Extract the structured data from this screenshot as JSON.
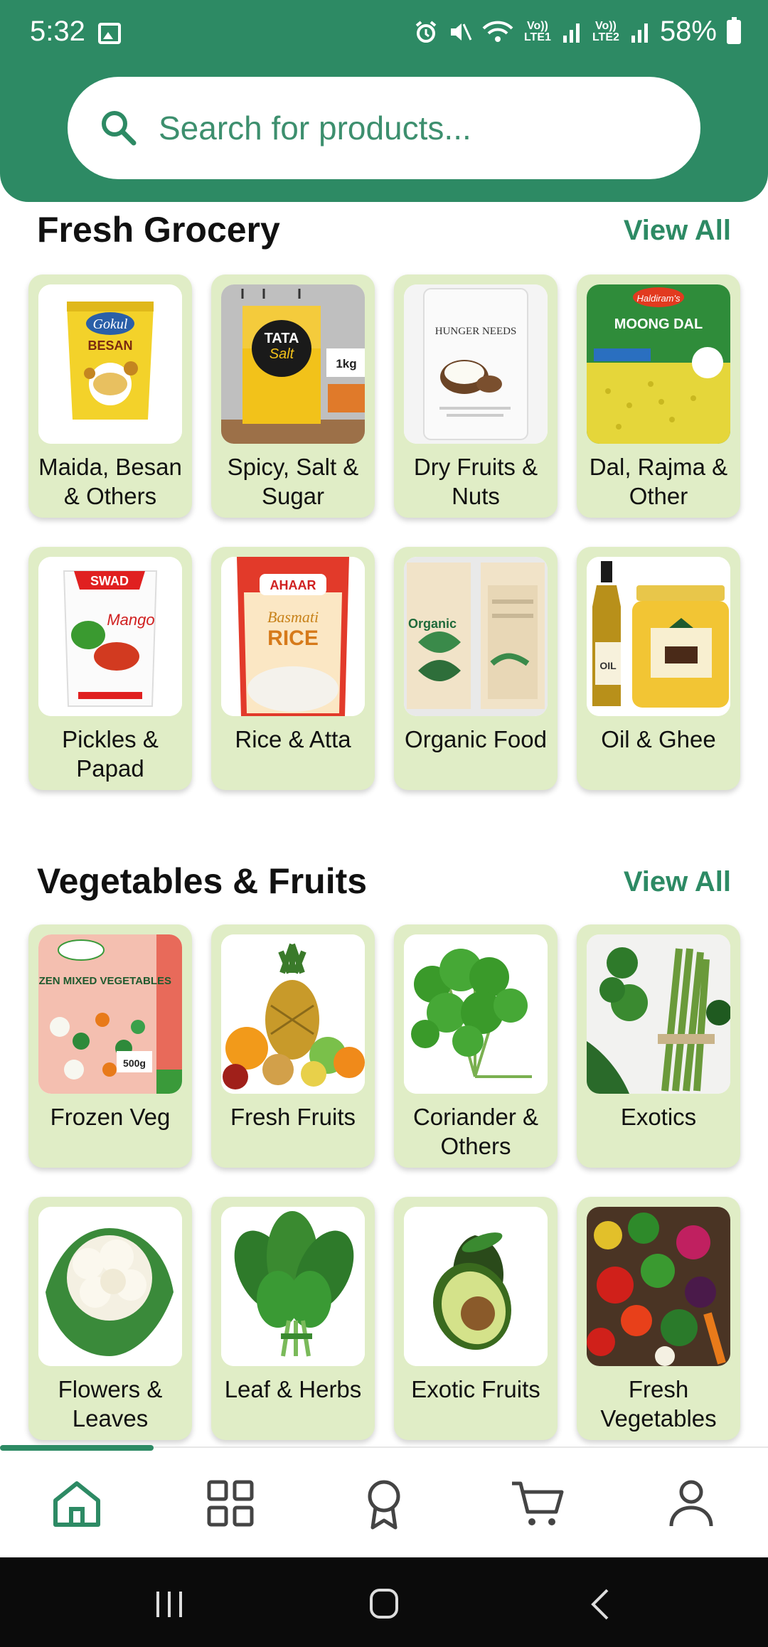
{
  "status_bar": {
    "time": "5:32",
    "battery": "58%",
    "network1": "Vo)) LTE1",
    "network2": "Vo)) LTE2"
  },
  "search": {
    "placeholder": "Search for products..."
  },
  "sections": [
    {
      "title": "Fresh Grocery",
      "view_all": "View All",
      "categories": [
        {
          "label": "Maida, Besan & Others"
        },
        {
          "label": "Spicy, Salt & Sugar"
        },
        {
          "label": "Dry Fruits & Nuts"
        },
        {
          "label": "Dal, Rajma & Other"
        },
        {
          "label": "Pickles & Papad"
        },
        {
          "label": "Rice & Atta"
        },
        {
          "label": "Organic Food"
        },
        {
          "label": "Oil & Ghee"
        }
      ]
    },
    {
      "title": "Vegetables & Fruits",
      "view_all": "View All",
      "categories": [
        {
          "label": "Frozen Veg"
        },
        {
          "label": "Fresh Fruits"
        },
        {
          "label": "Coriander & Others"
        },
        {
          "label": "Exotics"
        },
        {
          "label": "Flowers & Leaves"
        },
        {
          "label": "Leaf & Herbs"
        },
        {
          "label": "Exotic Fruits"
        },
        {
          "label": "Fresh Vegetables"
        }
      ]
    }
  ],
  "product_text": {
    "gokul": "Gokul",
    "besan": "BESAN",
    "tata": "TATA",
    "salt": "Salt",
    "kg": "1kg",
    "hunger": "HUNGER NEEDS",
    "haldiram": "Haldiram's",
    "moong": "MOONG DAL",
    "swad": "SWAD",
    "mango": "Mango",
    "ahaar": "AHAAR",
    "basmati": "Basmati",
    "rice": "RICE",
    "organic": "Organic",
    "oil": "OIL",
    "frozen": "FROZEN MIXED VEGETABLES",
    "g500": "500g"
  },
  "bottom_nav": [
    "home-icon",
    "categories-icon",
    "rewards-icon",
    "cart-icon",
    "profile-icon"
  ],
  "colors": {
    "primary": "#2d8a64",
    "card_bg": "#e0edc6"
  }
}
